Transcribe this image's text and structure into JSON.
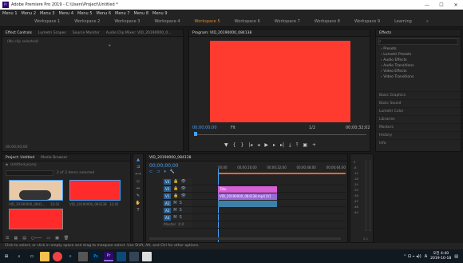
{
  "window": {
    "title": "Adobe Premiere Pro 2019 - C:\\Users\\Project\\Untitled *",
    "controls": [
      "—",
      "☐",
      "✕"
    ]
  },
  "menu": [
    "Menu 1",
    "Menu 2",
    "Menu 3",
    "Menu 4",
    "Menu 5",
    "Menu 6",
    "Menu 7",
    "Menu 8",
    "Menu 9"
  ],
  "workspaces": {
    "items": [
      "Workspace 1",
      "Workspace 2",
      "Workspace 3",
      "Workspace 4",
      "Workspace 5",
      "Workspace 6",
      "Workspace 7",
      "Workspace 8",
      "Workspace 9",
      "Learning"
    ],
    "active_index": 4,
    "more": "»"
  },
  "effect_controls": {
    "tabs": [
      "Effect Controls",
      "Lumetri Scopes",
      "Source Monitor",
      "Audio Clip Mixer: VID_20190000_0..."
    ],
    "message": "(No clip selected)",
    "time": "00;00;00;00"
  },
  "program": {
    "title": "Program: VID_20190000_084138",
    "timecode": "00;00;00;00",
    "fit": "Fit",
    "zoom": "1/2",
    "duration": "00;00;32;02",
    "frame_color": "#ff3b30",
    "transport": [
      "▼",
      "{",
      "}",
      "|◂",
      "◂|",
      "◂",
      "▶",
      "▸",
      "|▸",
      "▸|",
      "⤓",
      "⤒",
      "⊞",
      "⊟",
      "▣",
      "+"
    ]
  },
  "effects": {
    "title": "Effects",
    "groups": [
      "Presets",
      "Lumetri Presets",
      "Audio Effects",
      "Audio Transitions",
      "Video Effects",
      "Video Transitions"
    ],
    "sections": [
      "Basic Graphics",
      "Basic Sound",
      "Lumetri Color",
      "Libraries",
      "Markers",
      "History",
      "Info"
    ]
  },
  "project": {
    "tabs": [
      "Project: Untitled",
      "Media Browser"
    ],
    "file": "Untitled.prproj",
    "count": "2 of 3 items selected",
    "items": [
      {
        "name": "VID_20190000_0841...",
        "dur": "32;02"
      },
      {
        "name": "VID_20190000_084138",
        "dur": "32;02"
      },
      {
        "name": "Clip 3",
        "dur": ""
      }
    ],
    "thumb_color": "#ff2a2a"
  },
  "timeline": {
    "title": "VID_20190000_084138",
    "timecode": "00;00;00;00",
    "ruler": [
      "00;00",
      "00;00;16;00",
      "00;00;32;00",
      "00;00;48;00",
      "00;00;64;00"
    ],
    "video_tracks": [
      "V3",
      "V2",
      "V1"
    ],
    "audio_tracks": [
      "A1",
      "A2",
      "A3"
    ],
    "master": "Master",
    "master_val": "0.0",
    "clips": {
      "title_clip": "Title",
      "video_clip": "VID_20190000_084138.mp4 [V]",
      "audio_clip": ""
    }
  },
  "meters": {
    "scale": [
      "0",
      "-6",
      "-12",
      "-18",
      "-24",
      "-30",
      "-36",
      "-42",
      "-48",
      "-54"
    ],
    "footer": "S S"
  },
  "status": "Click to select, or click in empty space and drag to marquee select. Use Shift, Alt, and Ctrl for other options.",
  "taskbar": {
    "time": "오전 4:40",
    "date": "2019-10-18",
    "lang": "A",
    "icons": [
      "windows-icon",
      "search-icon",
      "task-view-icon",
      "explorer-icon",
      "chrome-icon",
      "edge-icon",
      "store-icon",
      "photoshop-icon",
      "premiere-icon",
      "app-icon",
      "app-icon2",
      "app-icon3"
    ]
  }
}
